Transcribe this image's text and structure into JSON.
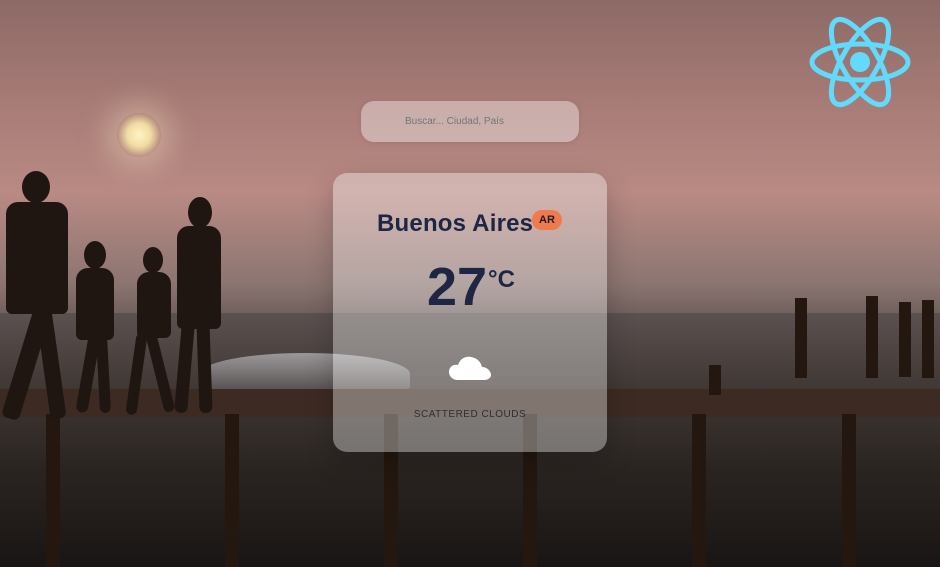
{
  "app": {
    "background": "sunset-beach-pier"
  },
  "search": {
    "placeholder": "Buscar... Ciudad, País"
  },
  "weather": {
    "city": "Buenos Aires",
    "country": "AR",
    "temperature": "27",
    "unit": "°C",
    "description": "SCATTERED CLOUDS",
    "icon": "cloud-icon"
  },
  "branding": {
    "icon": "react-logo-icon",
    "color": "#61dafb"
  },
  "colors": {
    "card_text": "#1e2644",
    "country_badge": "#ef7a4d"
  }
}
